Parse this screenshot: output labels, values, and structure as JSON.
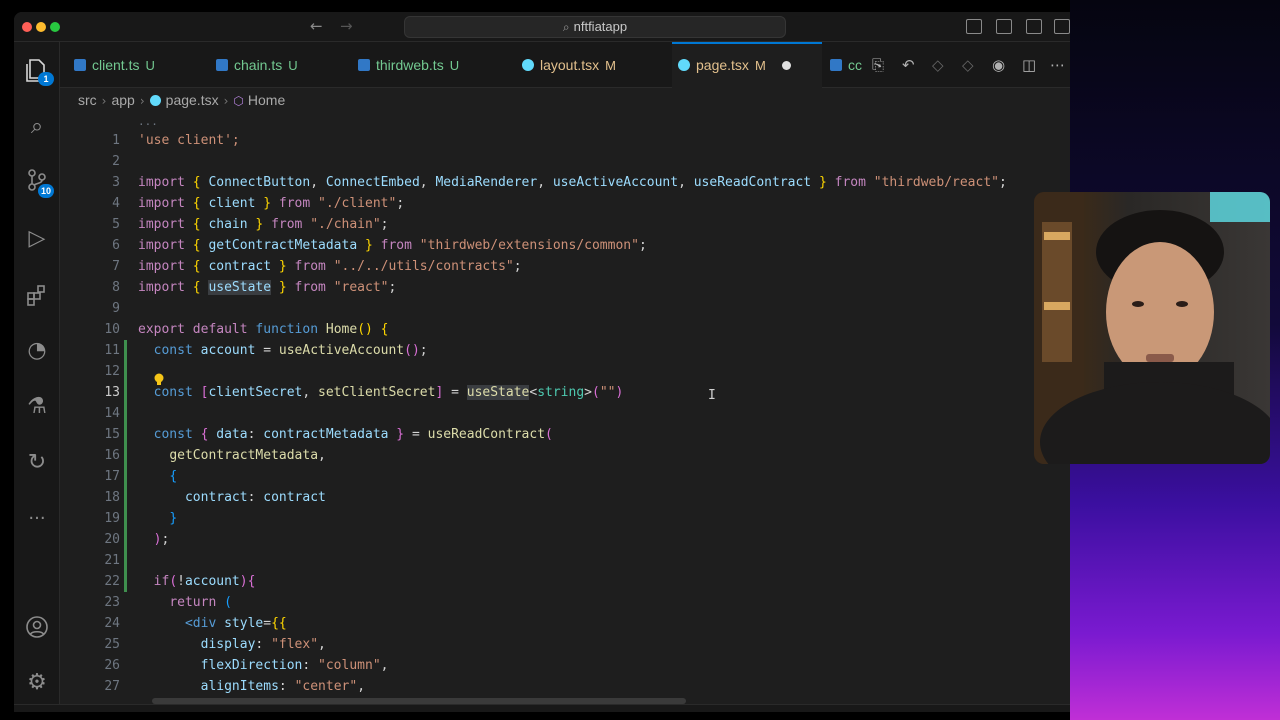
{
  "window": {
    "search_text": "nftfiatapp"
  },
  "activity_bar": {
    "explorer_badge": "1",
    "source_control_badge": "10"
  },
  "tabs": [
    {
      "label": "client.ts",
      "status": "U",
      "icon_color": "#3178c6"
    },
    {
      "label": "chain.ts",
      "status": "U",
      "icon_color": "#3178c6"
    },
    {
      "label": "thirdweb.ts",
      "status": "U",
      "icon_color": "#3178c6"
    },
    {
      "label": "layout.tsx",
      "status": "M",
      "icon_color": "#61dafb"
    },
    {
      "label": "page.tsx",
      "status": "M",
      "icon_color": "#61dafb",
      "active": true,
      "dirty": true
    },
    {
      "label": "cc",
      "status": "",
      "icon_color": "#3178c6"
    }
  ],
  "breadcrumb": {
    "parts": [
      "src",
      "app",
      "page.tsx",
      "Home"
    ]
  },
  "editor": {
    "current_line": 13,
    "lines": [
      {
        "n": "1",
        "tokens": [
          [
            "s",
            "'use client';"
          ]
        ]
      },
      {
        "n": "2",
        "tokens": []
      },
      {
        "n": "3",
        "tokens": [
          [
            "k",
            "import "
          ],
          [
            "b1",
            "{ "
          ],
          [
            "v",
            "ConnectButton"
          ],
          [
            "p",
            ", "
          ],
          [
            "v",
            "ConnectEmbed"
          ],
          [
            "p",
            ", "
          ],
          [
            "v",
            "MediaRenderer"
          ],
          [
            "p",
            ", "
          ],
          [
            "v",
            "useActiveAccount"
          ],
          [
            "p",
            ", "
          ],
          [
            "v",
            "useReadContract"
          ],
          [
            "b1",
            " }"
          ],
          [
            "k",
            " from "
          ],
          [
            "s",
            "\"thirdweb/react\""
          ],
          [
            "p",
            ";"
          ]
        ]
      },
      {
        "n": "4",
        "tokens": [
          [
            "k",
            "import "
          ],
          [
            "b1",
            "{ "
          ],
          [
            "v",
            "client"
          ],
          [
            "b1",
            " }"
          ],
          [
            "k",
            " from "
          ],
          [
            "s",
            "\"./client\""
          ],
          [
            "p",
            ";"
          ]
        ]
      },
      {
        "n": "5",
        "tokens": [
          [
            "k",
            "import "
          ],
          [
            "b1",
            "{ "
          ],
          [
            "v",
            "chain"
          ],
          [
            "b1",
            " }"
          ],
          [
            "k",
            " from "
          ],
          [
            "s",
            "\"./chain\""
          ],
          [
            "p",
            ";"
          ]
        ]
      },
      {
        "n": "6",
        "tokens": [
          [
            "k",
            "import "
          ],
          [
            "b1",
            "{ "
          ],
          [
            "v",
            "getContractMetadata"
          ],
          [
            "b1",
            " }"
          ],
          [
            "k",
            " from "
          ],
          [
            "s",
            "\"thirdweb/extensions/common\""
          ],
          [
            "p",
            ";"
          ]
        ]
      },
      {
        "n": "7",
        "tokens": [
          [
            "k",
            "import "
          ],
          [
            "b1",
            "{ "
          ],
          [
            "v",
            "contract"
          ],
          [
            "b1",
            " }"
          ],
          [
            "k",
            " from "
          ],
          [
            "s",
            "\"../../utils/contracts\""
          ],
          [
            "p",
            ";"
          ]
        ]
      },
      {
        "n": "8",
        "tokens": [
          [
            "k",
            "import "
          ],
          [
            "b1",
            "{ "
          ],
          [
            "vsel",
            "useState"
          ],
          [
            "b1",
            " }"
          ],
          [
            "k",
            " from "
          ],
          [
            "s",
            "\"react\""
          ],
          [
            "p",
            ";"
          ]
        ]
      },
      {
        "n": "9",
        "tokens": []
      },
      {
        "n": "10",
        "tokens": [
          [
            "k",
            "export "
          ],
          [
            "k",
            "default "
          ],
          [
            "kb",
            "function "
          ],
          [
            "f",
            "Home"
          ],
          [
            "b1",
            "()"
          ],
          [
            "p",
            " "
          ],
          [
            "b1",
            "{"
          ]
        ]
      },
      {
        "n": "11",
        "tokens": [
          [
            "p",
            "  "
          ],
          [
            "kb",
            "const "
          ],
          [
            "v",
            "account"
          ],
          [
            "p",
            " = "
          ],
          [
            "f",
            "useActiveAccount"
          ],
          [
            "b2",
            "()"
          ],
          [
            "p",
            ";"
          ]
        ]
      },
      {
        "n": "12",
        "tokens": []
      },
      {
        "n": "13",
        "tokens": [
          [
            "p",
            "  "
          ],
          [
            "kb",
            "const "
          ],
          [
            "b2",
            "["
          ],
          [
            "v",
            "clientSecret"
          ],
          [
            "p",
            ", "
          ],
          [
            "f",
            "setClientSecret"
          ],
          [
            "b2",
            "]"
          ],
          [
            "p",
            " = "
          ],
          [
            "fsel",
            "useState"
          ],
          [
            "p",
            "<"
          ],
          [
            "t",
            "string"
          ],
          [
            "p",
            ">"
          ],
          [
            "b2",
            "("
          ],
          [
            "s",
            "\"\""
          ],
          [
            "b2",
            ")"
          ]
        ]
      },
      {
        "n": "14",
        "tokens": []
      },
      {
        "n": "15",
        "tokens": [
          [
            "p",
            "  "
          ],
          [
            "kb",
            "const "
          ],
          [
            "b2",
            "{ "
          ],
          [
            "v",
            "data"
          ],
          [
            "p",
            ": "
          ],
          [
            "v",
            "contractMetadata"
          ],
          [
            "b2",
            " }"
          ],
          [
            "p",
            " = "
          ],
          [
            "f",
            "useReadContract"
          ],
          [
            "b2",
            "("
          ]
        ]
      },
      {
        "n": "16",
        "tokens": [
          [
            "p",
            "    "
          ],
          [
            "f",
            "getContractMetadata"
          ],
          [
            "p",
            ","
          ]
        ]
      },
      {
        "n": "17",
        "tokens": [
          [
            "p",
            "    "
          ],
          [
            "b3",
            "{"
          ]
        ]
      },
      {
        "n": "18",
        "tokens": [
          [
            "p",
            "      "
          ],
          [
            "v",
            "contract"
          ],
          [
            "p",
            ": "
          ],
          [
            "v",
            "contract"
          ]
        ]
      },
      {
        "n": "19",
        "tokens": [
          [
            "p",
            "    "
          ],
          [
            "b3",
            "}"
          ]
        ]
      },
      {
        "n": "20",
        "tokens": [
          [
            "p",
            "  "
          ],
          [
            "b2",
            ")"
          ],
          [
            "p",
            ";"
          ]
        ]
      },
      {
        "n": "21",
        "tokens": []
      },
      {
        "n": "22",
        "tokens": [
          [
            "p",
            "  "
          ],
          [
            "k",
            "if"
          ],
          [
            "b2",
            "("
          ],
          [
            "p",
            "!"
          ],
          [
            "v",
            "account"
          ],
          [
            "b2",
            ")"
          ],
          [
            "b2",
            "{"
          ]
        ]
      },
      {
        "n": "23",
        "tokens": [
          [
            "p",
            "    "
          ],
          [
            "k",
            "return "
          ],
          [
            "b3",
            "("
          ]
        ]
      },
      {
        "n": "24",
        "tokens": [
          [
            "p",
            "      "
          ],
          [
            "kb",
            "<div "
          ],
          [
            "v",
            "style"
          ],
          [
            "p",
            "="
          ],
          [
            "b1",
            "{{"
          ]
        ]
      },
      {
        "n": "25",
        "tokens": [
          [
            "p",
            "        "
          ],
          [
            "v",
            "display"
          ],
          [
            "p",
            ": "
          ],
          [
            "s",
            "\"flex\""
          ],
          [
            "p",
            ","
          ]
        ]
      },
      {
        "n": "26",
        "tokens": [
          [
            "p",
            "        "
          ],
          [
            "v",
            "flexDirection"
          ],
          [
            "p",
            ": "
          ],
          [
            "s",
            "\"column\""
          ],
          [
            "p",
            ","
          ]
        ]
      },
      {
        "n": "27",
        "tokens": [
          [
            "p",
            "        "
          ],
          [
            "v",
            "alignItems"
          ],
          [
            "p",
            ": "
          ],
          [
            "s",
            "\"center\""
          ],
          [
            "p",
            ","
          ]
        ]
      }
    ]
  }
}
